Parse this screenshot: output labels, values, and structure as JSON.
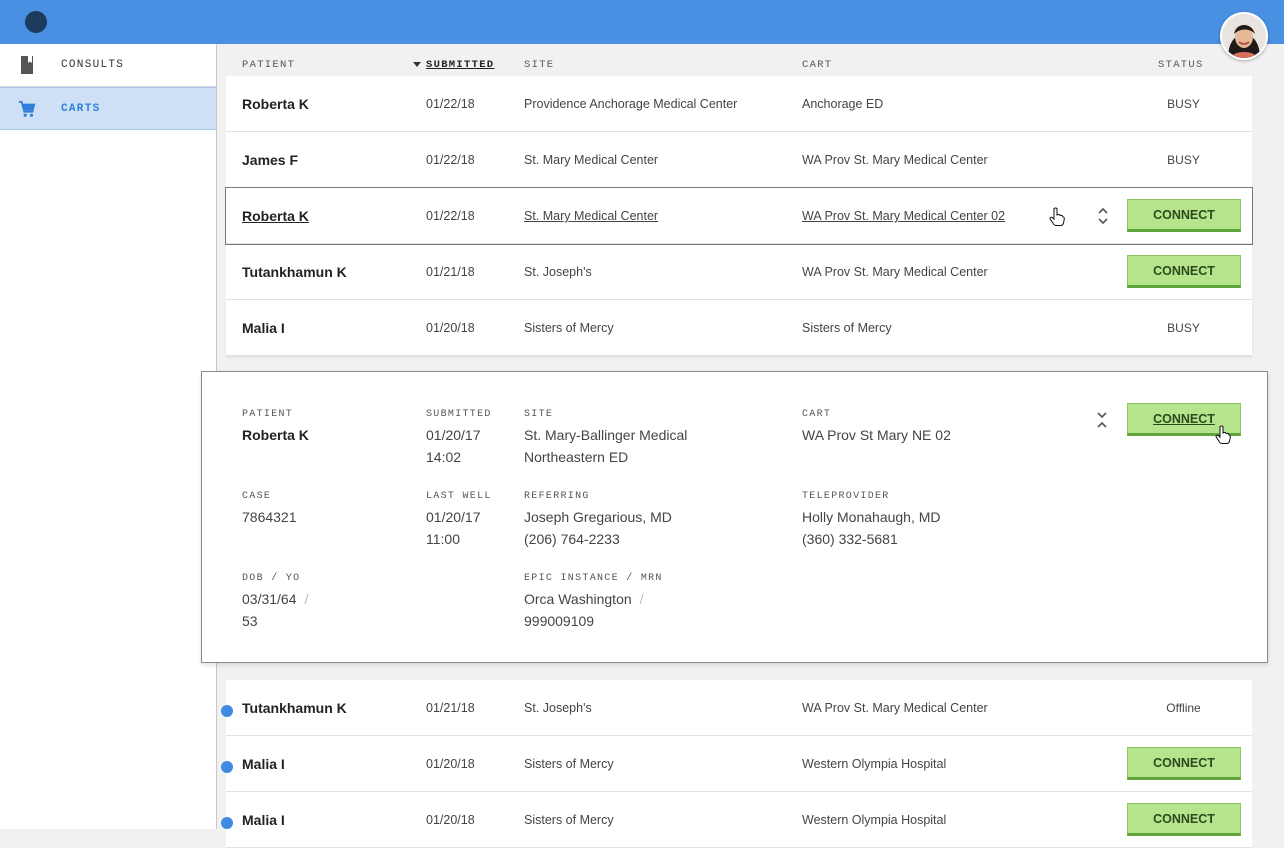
{
  "sidebar": {
    "items": [
      {
        "label": "CONSULTS",
        "icon": "book-icon"
      },
      {
        "label": "CARTS",
        "icon": "cart-icon"
      }
    ]
  },
  "table": {
    "headers": {
      "patient": "PATIENT",
      "submitted": "SUBMITTED",
      "site": "SITE",
      "cart": "CART",
      "status": "STATUS"
    },
    "rows": [
      {
        "patient": "Roberta K",
        "submitted": "01/22/18",
        "site": "Providence Anchorage Medical Center",
        "cart": "Anchorage ED",
        "status": "BUSY"
      },
      {
        "patient": "James F",
        "submitted": "01/22/18",
        "site": "St. Mary Medical Center",
        "cart": "WA Prov St. Mary Medical Center",
        "status": "BUSY"
      },
      {
        "patient": "Roberta K",
        "submitted": "01/22/18",
        "site": "St. Mary Medical Center",
        "cart": "WA Prov St. Mary Medical Center 02",
        "action": "CONNECT"
      },
      {
        "patient": "Tutankhamun K",
        "submitted": "01/21/18",
        "site": "St. Joseph's",
        "cart": "WA Prov St. Mary Medical Center",
        "action": "CONNECT"
      },
      {
        "patient": "Malia I",
        "submitted": "01/20/18",
        "site": "Sisters of Mercy",
        "cart": "Sisters of Mercy",
        "status": "BUSY"
      }
    ],
    "lower_rows": [
      {
        "patient": "Tutankhamun K",
        "submitted": "01/21/18",
        "site": "St. Joseph's",
        "cart": "WA Prov St. Mary Medical Center",
        "status": "Offline"
      },
      {
        "patient": "Malia I",
        "submitted": "01/20/18",
        "site": "Sisters of Mercy",
        "cart": "Western Olympia Hospital",
        "action": "CONNECT"
      },
      {
        "patient": "Malia I",
        "submitted": "01/20/18",
        "site": "Sisters of Mercy",
        "cart": "Western Olympia Hospital",
        "action": "CONNECT"
      }
    ]
  },
  "detail": {
    "patient_label": "PATIENT",
    "patient": "Roberta K",
    "submitted_label": "SUBMITTED",
    "submitted_date": "01/20/17",
    "submitted_time": "14:02",
    "site_label": "SITE",
    "site_line1": "St. Mary-Ballinger Medical",
    "site_line2": "Northeastern ED",
    "cart_label": "CART",
    "cart": "WA Prov St Mary NE 02",
    "case_label": "CASE",
    "case": "7864321",
    "last_well_label": "LAST WELL",
    "last_well_date": "01/20/17",
    "last_well_time": "11:00",
    "referring_label": "REFERRING",
    "referring_name": "Joseph Gregarious, MD",
    "referring_phone": "(206) 764-2233",
    "teleprovider_label": "TELEPROVIDER",
    "teleprovider_name": "Holly Monahaugh, MD",
    "teleprovider_phone": "(360) 332-5681",
    "dob_label": "DOB / YO",
    "dob": "03/31/64",
    "separator": "/",
    "age": "53",
    "epic_label": "EPIC INSTANCE / MRN",
    "epic_instance": "Orca Washington",
    "mrn": "999009109",
    "action": "CONNECT"
  },
  "colors": {
    "header_bg": "#4a90e2",
    "active_nav_bg": "#cde0f6",
    "connect_bg": "#b5e48c",
    "unread_dot": "#3f8ae0"
  }
}
